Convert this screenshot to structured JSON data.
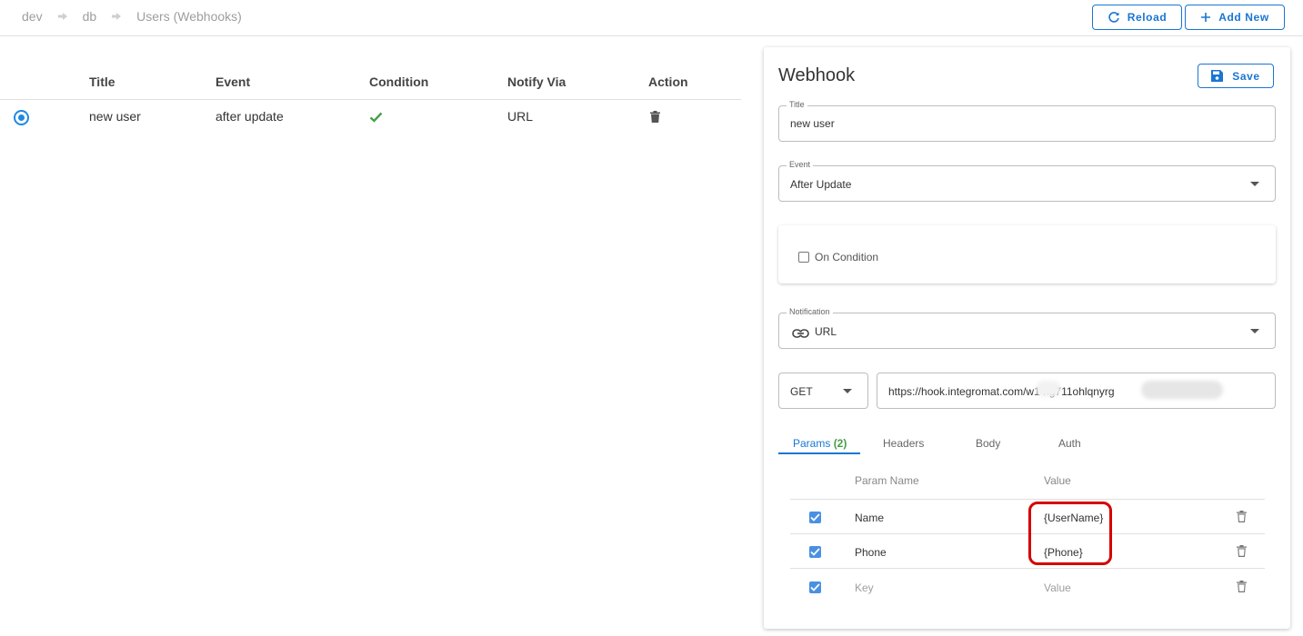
{
  "breadcrumb": {
    "items": [
      "dev",
      "db",
      "Users (Webhooks)"
    ]
  },
  "toolbar": {
    "reload_label": "Reload",
    "add_new_label": "Add New"
  },
  "table": {
    "headers": [
      "Title",
      "Event",
      "Condition",
      "Notify Via",
      "Action"
    ],
    "rows": [
      {
        "title": "new user",
        "event": "after update",
        "condition": true,
        "notify_via": "URL"
      }
    ]
  },
  "panel": {
    "title": "Webhook",
    "save_label": "Save",
    "title_field": {
      "label": "Title",
      "value": "new user"
    },
    "event_field": {
      "label": "Event",
      "value": "After Update"
    },
    "on_condition": {
      "label": "On Condition",
      "checked": false
    },
    "notification_field": {
      "label": "Notification",
      "value": "URL"
    },
    "method": "GET",
    "url": "https://hook.integromat.com/w1      ng711ohlqnyrg",
    "tabs": {
      "params": "Params",
      "params_count": "(2)",
      "headers": "Headers",
      "body": "Body",
      "auth": "Auth"
    },
    "params_table": {
      "col_name": "Param Name",
      "col_value": "Value",
      "rows": [
        {
          "checked": true,
          "name": "Name",
          "value": "{UserName}"
        },
        {
          "checked": true,
          "name": "Phone",
          "value": "{Phone}"
        }
      ],
      "new_row": {
        "checked": true,
        "name_placeholder": "Key",
        "value_placeholder": "Value"
      }
    }
  },
  "colors": {
    "accent": "#1976d2",
    "check_green": "#43a047",
    "checkbox_blue": "#4a90e2",
    "annotation_red": "#d50000"
  }
}
